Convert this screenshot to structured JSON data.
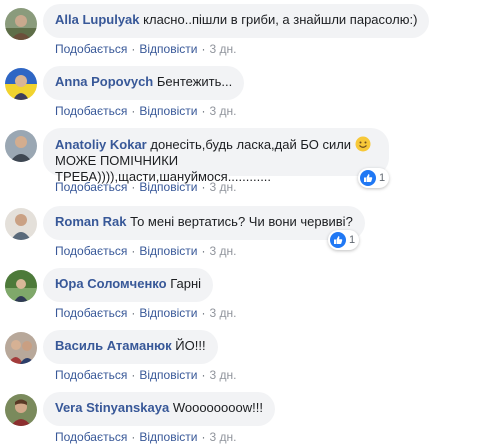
{
  "labels": {
    "like": "Подобається",
    "reply": "Відповісти",
    "separator": "·"
  },
  "comments": [
    {
      "author": "Alla Lupulyak",
      "text": "класно..пішли в гриби, а знайшли парасолю:)",
      "time": "3 дн."
    },
    {
      "author": "Anna Popovych",
      "text": "Бентежить...",
      "time": "3 дн."
    },
    {
      "author": "Anatoliy Kokar",
      "text_before": "донесіть,будь ласка,дай БО сили",
      "emoji": "smile-emoji",
      "text_after": "МОЖЕ ПОМІЧНИКИ ТРЕБА)))),щасти,шануймося............",
      "time": "3 дн.",
      "reactions": 1
    },
    {
      "author": "Roman Rak",
      "text": "То мені вертатись? Чи вони червиві?",
      "time": "3 дн.",
      "reactions": 1
    },
    {
      "author": "Юра Соломченко",
      "text": "Гарні",
      "time": "3 дн."
    },
    {
      "author": "Василь Атаманюк",
      "text": "ЙО!!!",
      "time": "3 дн."
    },
    {
      "author": "Vera Stinyanskaya",
      "text": "Woooooooow!!!",
      "time": "3 дн."
    }
  ],
  "colors": {
    "author": "#385898",
    "bubble": "#f2f3f5",
    "like_badge": "#2078f4",
    "meta": "#606770"
  },
  "icons": [
    "like-icon",
    "smile-emoji"
  ]
}
